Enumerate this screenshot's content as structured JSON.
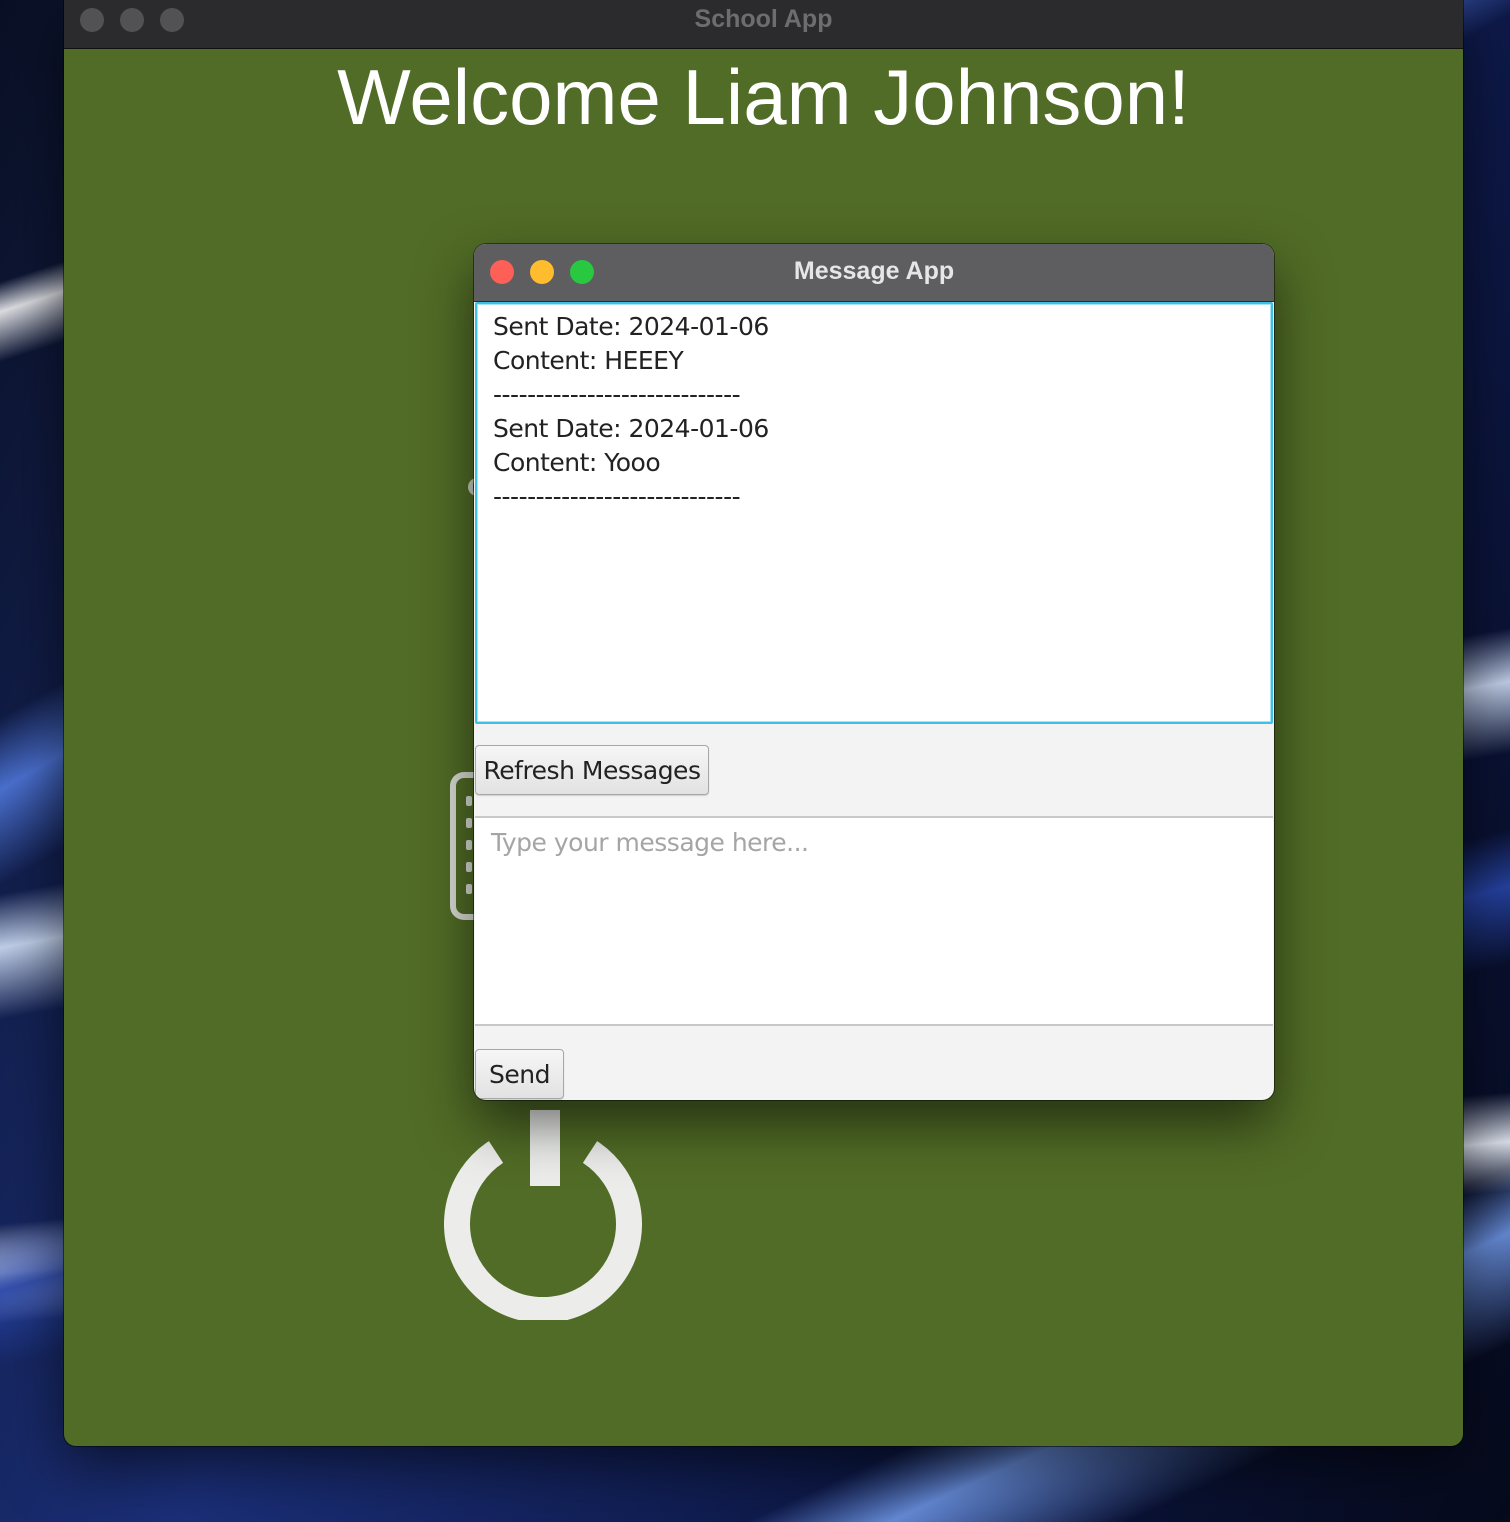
{
  "main_window": {
    "title": "School App",
    "welcome": "Welcome Liam Johnson!",
    "background_color": "#516c26"
  },
  "message_window": {
    "title": "Message App",
    "log_lines": [
      "Sent Date: 2024-01-06",
      "Content: HEEEY",
      "-----------------------------",
      "Sent Date: 2024-01-06",
      "Content: Yooo",
      "-----------------------------"
    ],
    "refresh_label": "Refresh Messages",
    "compose_placeholder": "Type your message here...",
    "send_label": "Send"
  },
  "icons": {
    "power": "power-icon",
    "list": "list-icon"
  },
  "colors": {
    "close": "#fe5f57",
    "minimize": "#febc2e",
    "zoom": "#28c840",
    "focus_border": "#3fc0e6"
  }
}
